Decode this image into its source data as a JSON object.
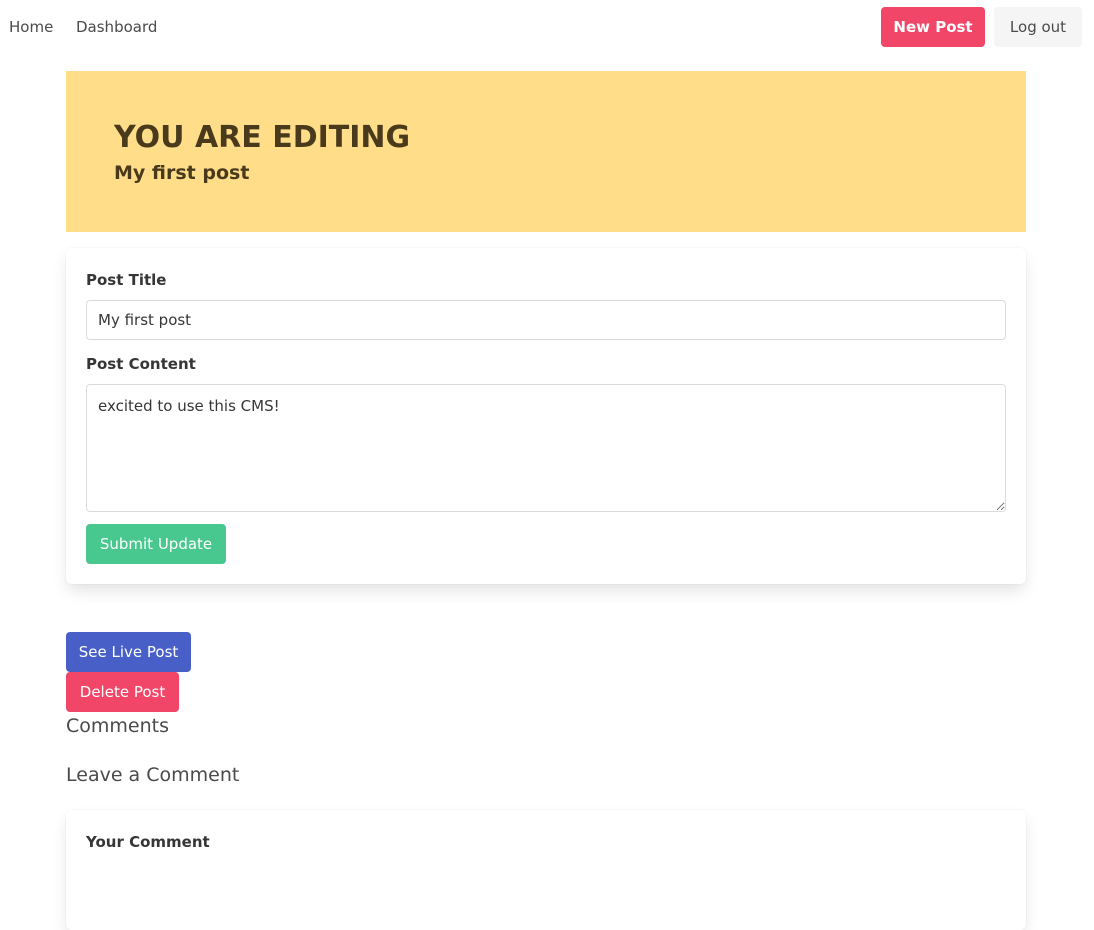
{
  "navbar": {
    "home_label": "Home",
    "dashboard_label": "Dashboard",
    "new_post_label": "New Post",
    "logout_label": "Log out"
  },
  "hero": {
    "title": "YOU ARE EDITING",
    "subtitle": "My first post"
  },
  "edit_form": {
    "title_label": "Post Title",
    "title_value": "My first post",
    "content_label": "Post Content",
    "content_value": "excited to use this CMS!",
    "submit_label": "Submit Update"
  },
  "post_actions": {
    "live_label": "See Live Post",
    "delete_label": "Delete Post"
  },
  "comments": {
    "heading": "Comments",
    "leave_heading": "Leave a Comment",
    "comment_label": "Your Comment"
  },
  "colors": {
    "hero_background": "#ffdd89",
    "danger": "#f14668",
    "success": "#48c78e",
    "link": "#485fc7",
    "light": "#f5f5f5"
  }
}
